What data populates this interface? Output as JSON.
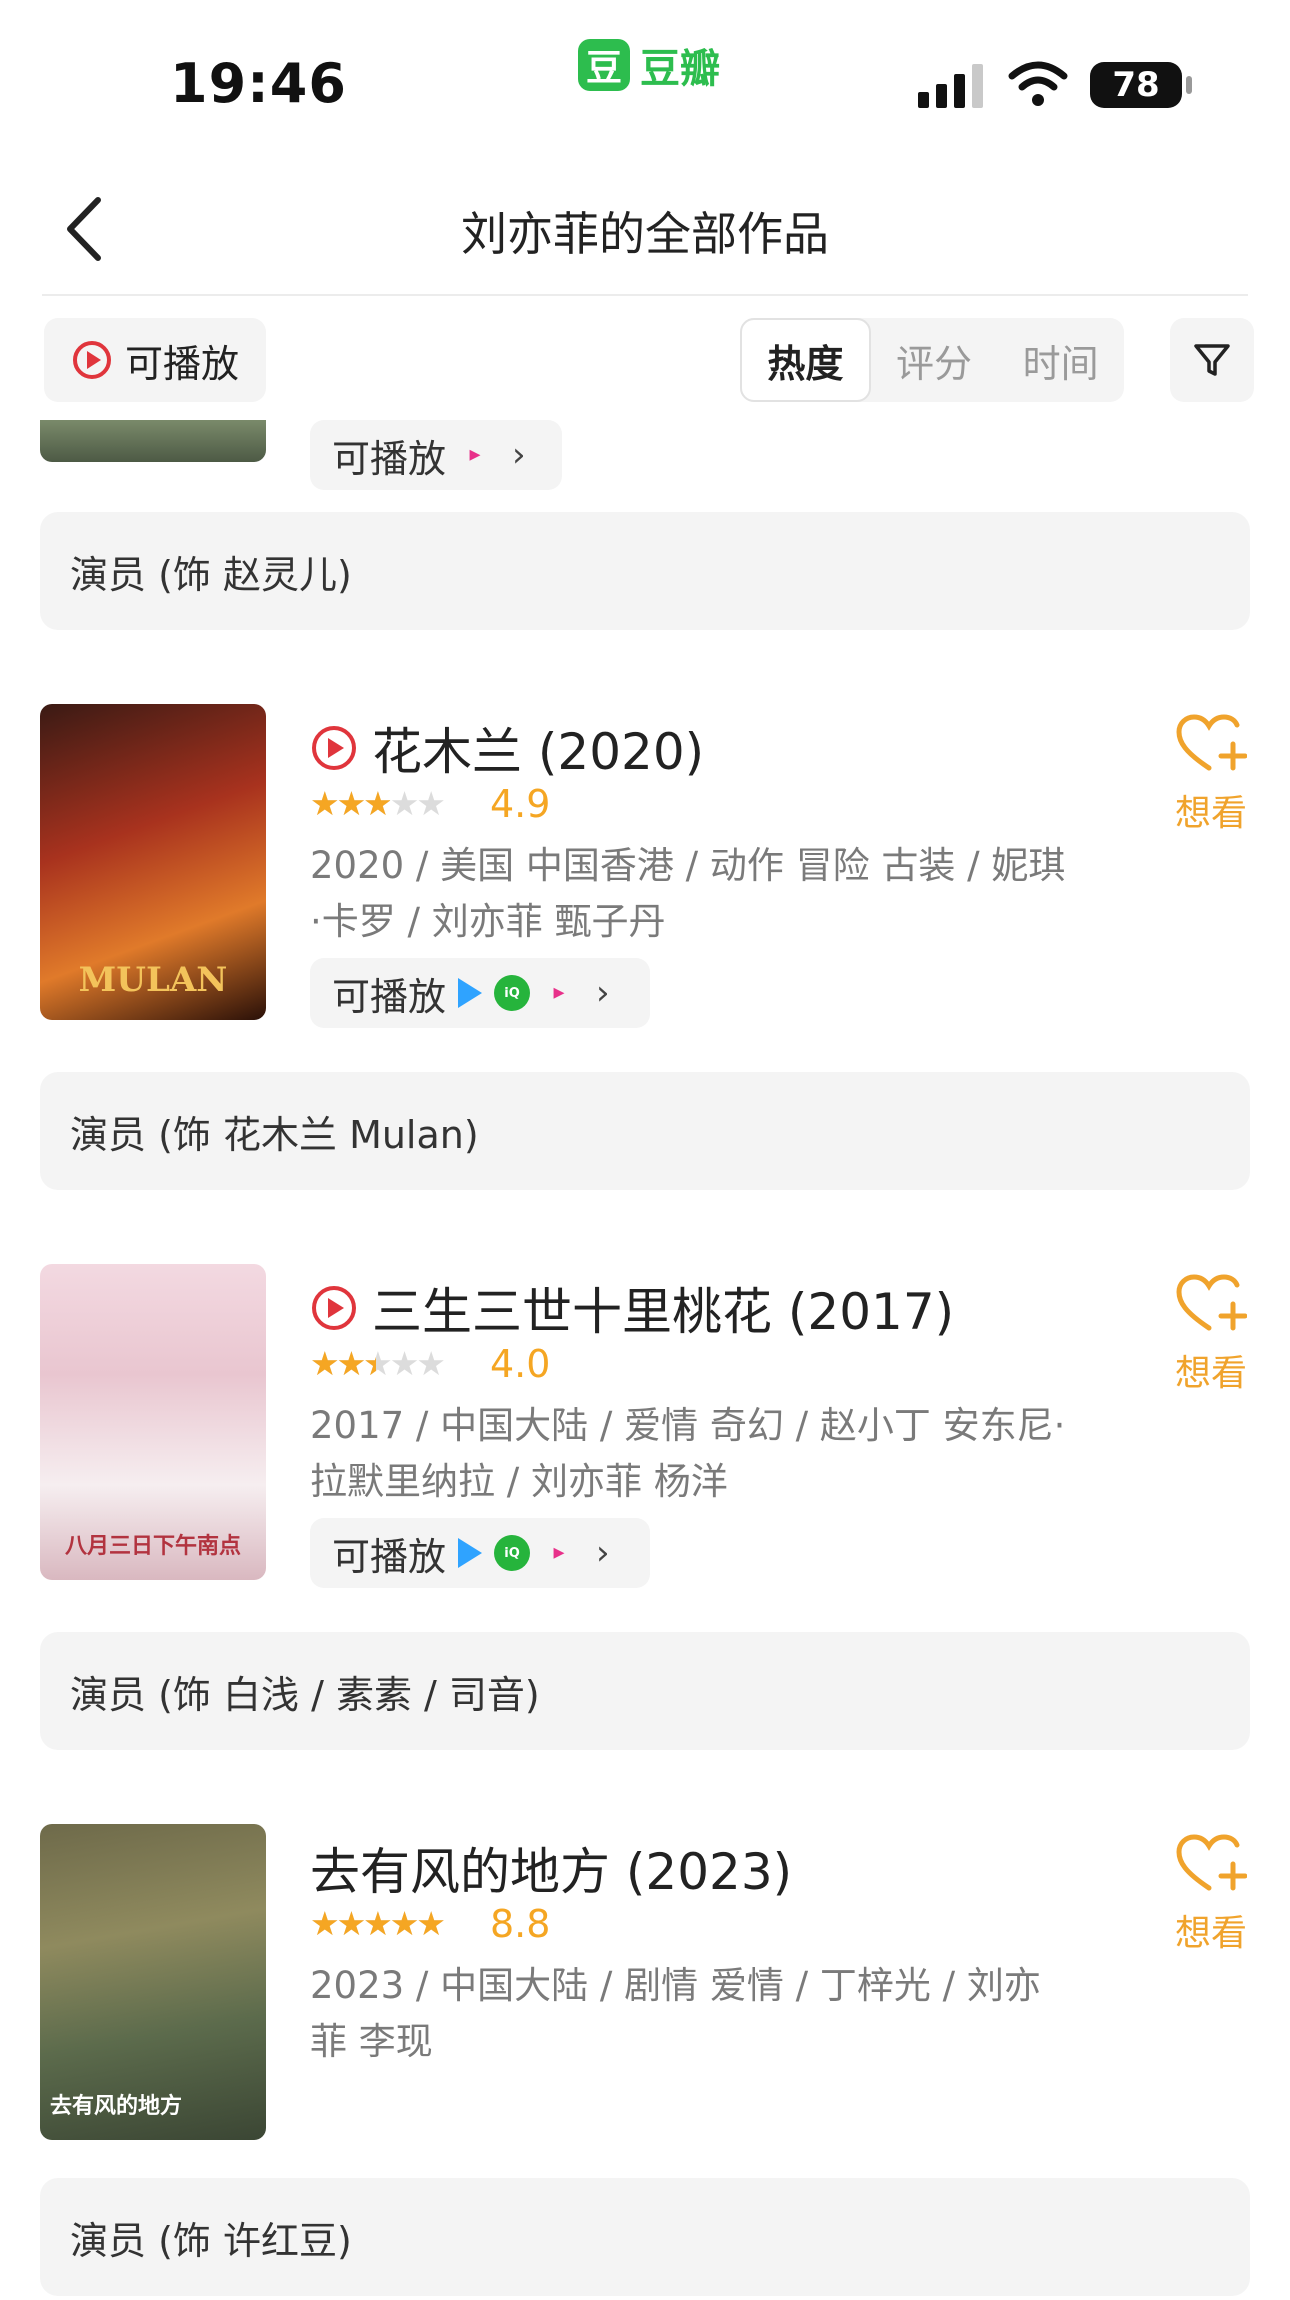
{
  "status_bar": {
    "time": "19:46",
    "app_logo": "豆",
    "app_name": "豆瓣",
    "battery": "78"
  },
  "nav": {
    "title": "刘亦菲的全部作品",
    "back_icon": "chevron-left-icon"
  },
  "filters": {
    "playable_label": "可播放",
    "sort_tabs": [
      {
        "label": "热度",
        "active": true
      },
      {
        "label": "评分",
        "active": false
      },
      {
        "label": "时间",
        "active": false
      }
    ],
    "filter_icon": "funnel-icon"
  },
  "partial_item": {
    "play_label": "可播放",
    "sources": [
      "YOUKU"
    ],
    "role": "演员 (饰 赵灵儿)"
  },
  "items": [
    {
      "title": "花木兰 (2020)",
      "playable": true,
      "rating": 4.9,
      "score": "4.9",
      "meta": "2020 / 美国 中国香港 / 动作 冒险 古装 / 妮琪·卡罗 / 刘亦菲 甄子丹",
      "play_label": "可播放",
      "sources": [
        "tencent",
        "iQIYI",
        "YOUKU"
      ],
      "want_label": "想看",
      "poster_text": "MULAN",
      "role": "演员 (饰 花木兰 Mulan)"
    },
    {
      "title": "三生三世十里桃花 (2017)",
      "playable": true,
      "rating": 4.0,
      "score": "4.0",
      "meta": "2017 / 中国大陆 / 爱情 奇幻 / 赵小丁 安东尼·拉默里纳拉 / 刘亦菲 杨洋",
      "play_label": "可播放",
      "sources": [
        "tencent",
        "iQIYI",
        "YOUKU"
      ],
      "want_label": "想看",
      "poster_text": "八月三日下午南点",
      "role": "演员 (饰 白浅 / 素素 / 司音)"
    },
    {
      "title": "去有风的地方 (2023)",
      "playable": false,
      "rating": 8.8,
      "score": "8.8",
      "meta": "2023 / 中国大陆 / 剧情 爱情 / 丁梓光 / 刘亦菲 李现",
      "want_label": "想看",
      "poster_text": "去有风的地方",
      "role": "演员 (饰 许红豆)"
    }
  ],
  "colors": {
    "accent_orange": "#f5a623",
    "play_red": "#e0353c",
    "douban_green": "#2dbd4e"
  }
}
